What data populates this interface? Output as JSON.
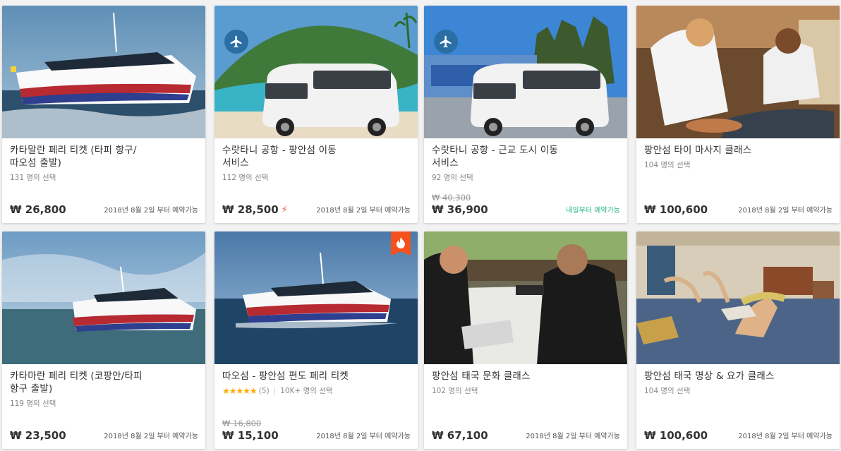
{
  "colors": {
    "price": "#333333",
    "available_green": "#26b58a",
    "star": "#ffab00",
    "hot_badge": "#f4511e",
    "plane_badge": "#2a6ea3"
  },
  "cards": [
    {
      "title_line1": "카타말란 페리 티켓 (타피 항구/",
      "title_line2": "따오섬 출발)",
      "booked": "131 명의 선택",
      "price": "₩ 26,800",
      "availability": "2018년 8월 2일 부터 예약가능",
      "image": "ferry-boat"
    },
    {
      "title_line1": "수랏타니 공항 - 팡안섬 이동",
      "title_line2": "서비스",
      "booked": "112 명의 선택",
      "price": "₩ 28,500",
      "availability": "2018년 8월 2일 부터 예약가능",
      "icon": "plane-icon",
      "instant_icon": "lightning-icon",
      "image": "van-beach"
    },
    {
      "title_line1": "수랏타니 공항 - 근교 도시 이동",
      "title_line2": "서비스",
      "booked": "92 명의 선택",
      "old_price": "₩ 40,300",
      "price": "₩ 36,900",
      "availability": "내일부터 예약가능",
      "icon": "plane-icon",
      "image": "van-airport"
    },
    {
      "title_line1": "팡안섬 타이 마사지 클래스",
      "title_line2": "",
      "booked": "104 명의 선택",
      "price": "₩ 100,600",
      "availability": "2018년 8월 2일 부터 예약가능",
      "image": "massage"
    },
    {
      "title_line1": "카타마란 페리 티켓 (코팡안/타피",
      "title_line2": "항구 출발)",
      "booked": "119 명의 선택",
      "price": "₩ 23,500",
      "availability": "2018년 8월 2일 부터 예약가능",
      "image": "ferry-sea"
    },
    {
      "title_line1": "따오섬 - 팡안섬 편도 페리 티켓",
      "title_line2": "",
      "stars": "★★★★★",
      "review_count": "(5)",
      "divider": "|",
      "booked": "10K+ 명의 선택",
      "old_price": "₩ 16,800",
      "price": "₩ 15,100",
      "availability": "2018년 8월 2일 부터 예약가능",
      "badge_icon": "flame-icon",
      "rating": 5,
      "image": "ferry-open"
    },
    {
      "title_line1": "팡안섬 태국 문화 클래스",
      "title_line2": "",
      "booked": "102 명의 선택",
      "price": "₩ 67,100",
      "availability": "2018년 8월 2일 부터 예약가능",
      "image": "classroom"
    },
    {
      "title_line1": "팡안섬 태국 명상 & 요가 클래스",
      "title_line2": "",
      "booked": "104 명의 선택",
      "price": "₩ 100,600",
      "availability": "2018년 8월 2일 부터 예약가능",
      "image": "yoga"
    }
  ]
}
